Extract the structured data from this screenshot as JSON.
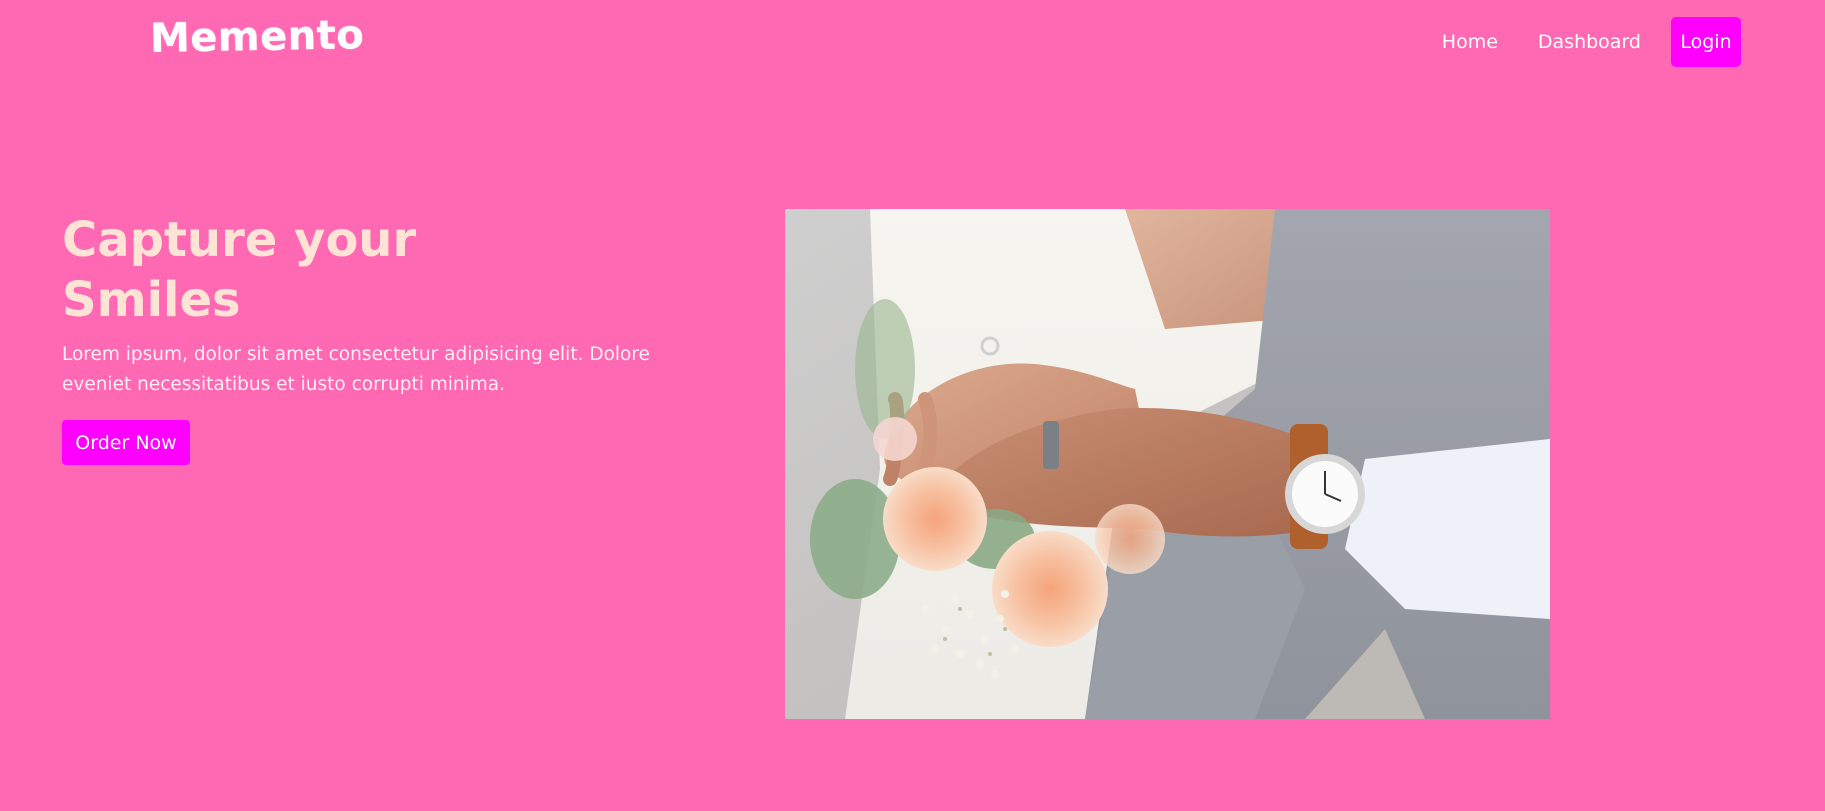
{
  "navbar": {
    "brand": "Memento",
    "links": [
      {
        "label": "Home"
      },
      {
        "label": "Dashboard"
      }
    ],
    "login_label": "Login"
  },
  "hero": {
    "title": "Capture your Smiles",
    "description": "Lorem ipsum, dolor sit amet consectetur adipisicing elit. Dolore eveniet necessitatibus et iusto corrupti minima.",
    "cta_label": "Order Now",
    "image_subject": "wedding-hands-rings-bouquet"
  },
  "colors": {
    "background": "#ff69b4",
    "accent": "#ff00ff",
    "title": "#ffe4d6",
    "text": "#ffffff"
  }
}
